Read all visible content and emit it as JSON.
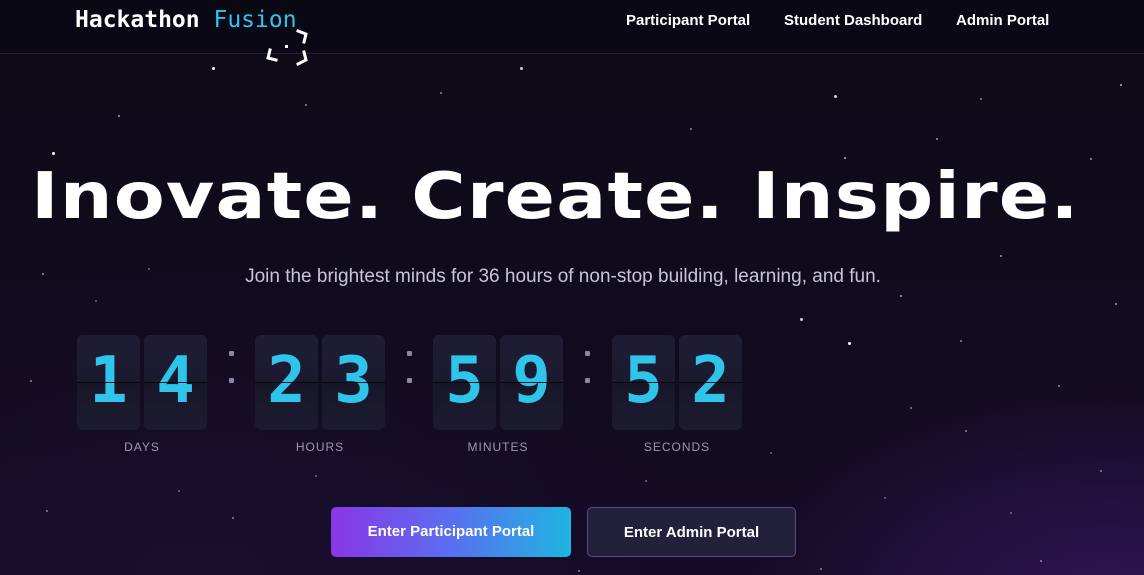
{
  "header": {
    "logo_main": "Hackathon",
    "logo_accent": "Fusion",
    "nav": [
      {
        "label": "Participant Portal"
      },
      {
        "label": "Student Dashboard"
      },
      {
        "label": "Admin Portal"
      }
    ]
  },
  "hero": {
    "title": "Inovate. Create. Inspire.",
    "subtitle": "Join the brightest minds for 36 hours of non-stop building, learning, and fun."
  },
  "countdown": {
    "days": {
      "digits": [
        "1",
        "4"
      ],
      "label": "DAYS"
    },
    "hours": {
      "digits": [
        "2",
        "3"
      ],
      "label": "HOURS"
    },
    "minutes": {
      "digits": [
        "5",
        "9"
      ],
      "label": "MINUTES"
    },
    "seconds": {
      "digits": [
        "5",
        "2"
      ],
      "label": "SECONDS"
    }
  },
  "actions": {
    "primary_label": "Enter Participant Portal",
    "secondary_label": "Enter Admin Portal"
  },
  "colors": {
    "accent": "#2fc4ea",
    "background": "#0e0a18",
    "button_gradient_start": "#8a36e6",
    "button_gradient_end": "#1fb5e0"
  },
  "icons": {
    "logo_mark": "focus-frame-icon"
  }
}
